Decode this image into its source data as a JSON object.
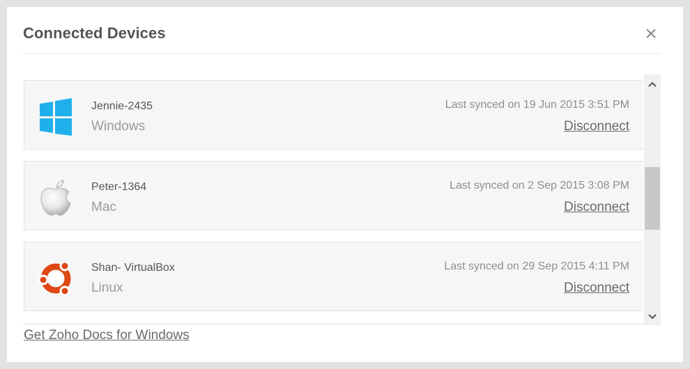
{
  "dialog": {
    "title": "Connected Devices",
    "close_icon": "close-icon"
  },
  "devices": [
    {
      "name": "Jennie-2435",
      "os": "Windows",
      "icon": "windows-logo-icon",
      "last_synced": "Last synced on 19 Jun 2015 3:51 PM",
      "action": "Disconnect"
    },
    {
      "name": "Peter-1364",
      "os": "Mac",
      "icon": "apple-logo-icon",
      "last_synced": "Last synced on 2 Sep 2015 3:08 PM",
      "action": "Disconnect"
    },
    {
      "name": "Shan- VirtualBox",
      "os": "Linux",
      "icon": "ubuntu-logo-icon",
      "last_synced": "Last synced on 29 Sep 2015 4:11 PM",
      "action": "Disconnect"
    }
  ],
  "scrollbar": {
    "up_icon": "chevron-up-icon",
    "down_icon": "chevron-down-icon"
  },
  "footer": {
    "link": "Get Zoho Docs for Windows"
  },
  "colors": {
    "windows_blue": "#1fb0ec",
    "ubuntu_orange": "#dd4814",
    "text_dark": "#555555",
    "text_muted": "#9a9a9a"
  }
}
